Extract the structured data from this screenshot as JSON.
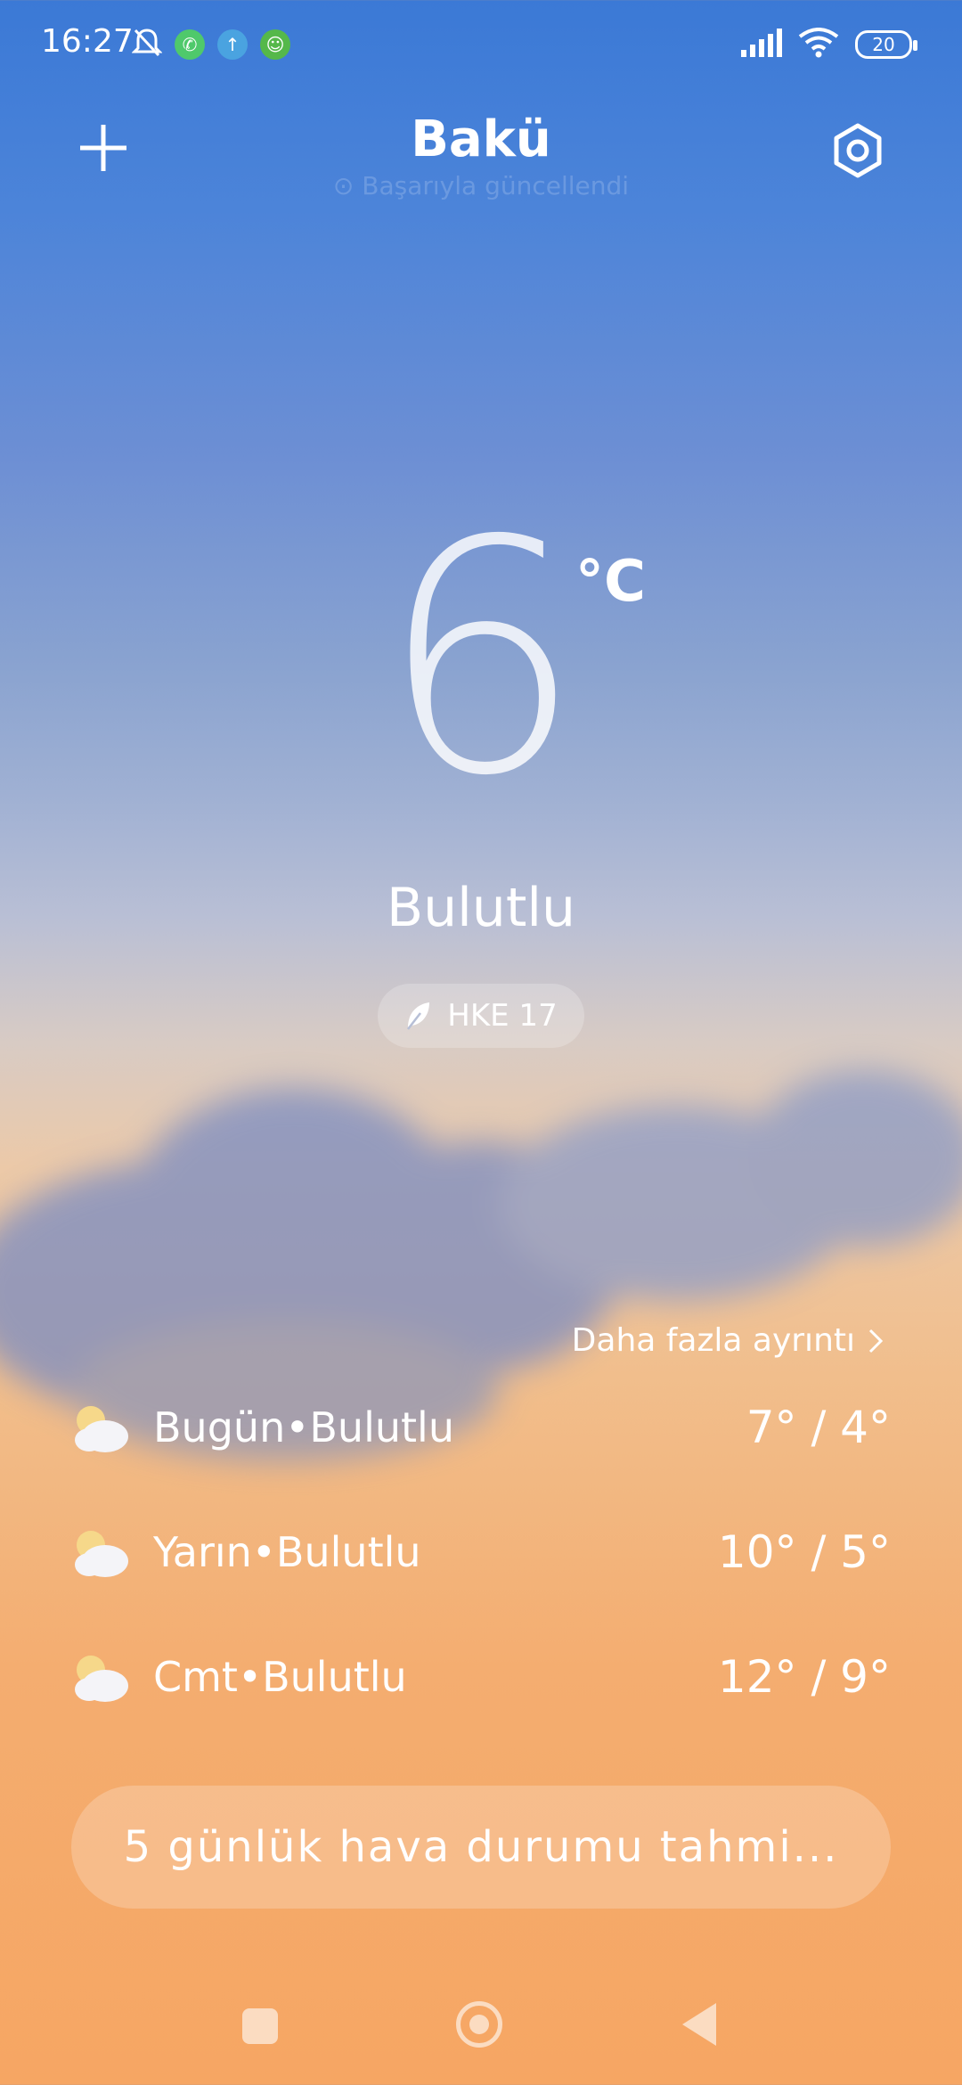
{
  "status_bar": {
    "time": "16:27",
    "battery": "20",
    "icons": [
      "bell-off-icon",
      "whatsapp-icon",
      "upload-icon",
      "android-icon",
      "signal-icon",
      "wifi-icon",
      "battery-icon"
    ]
  },
  "header": {
    "city": "Bakü",
    "updated": "Başarıyla güncellendi"
  },
  "current": {
    "temperature": "6",
    "unit": "°C",
    "condition": "Bulutlu",
    "aqi_label": "HKE 17"
  },
  "forecast": {
    "more_details": "Daha fazla ayrıntı",
    "rows": [
      {
        "label": "Bugün•Bulutlu",
        "temps": "7° / 4°"
      },
      {
        "label": "Yarın•Bulutlu",
        "temps": "10° / 5°"
      },
      {
        "label": "Cmt•Bulutlu",
        "temps": "12° / 9°"
      }
    ],
    "five_day_button": "5 günlük hava durumu tahmi..."
  },
  "colors": {
    "sky_top": "#3b79d6",
    "sky_bottom": "#f6a663",
    "sun": "#f6d88a"
  }
}
